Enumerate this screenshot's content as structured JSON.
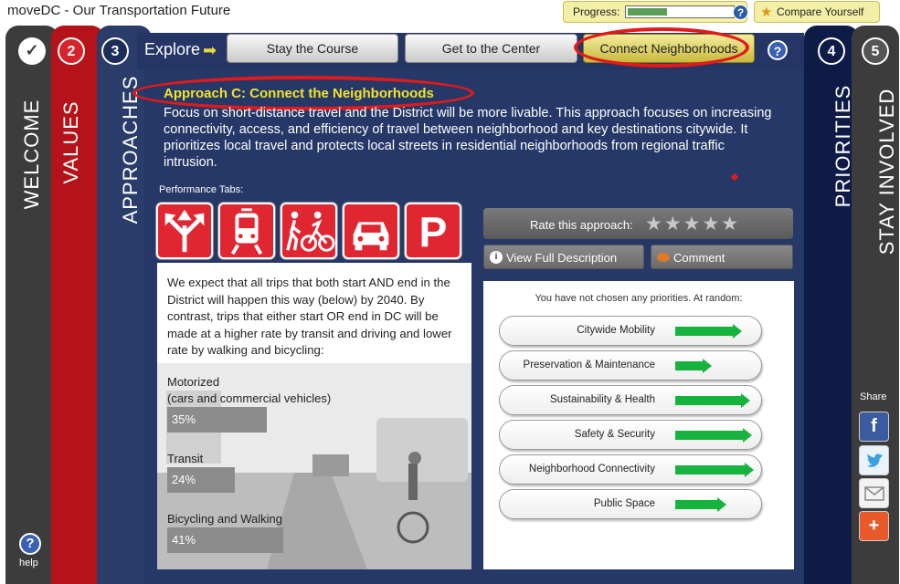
{
  "window": {
    "title": "moveDC - Our Transportation Future"
  },
  "topbar": {
    "progress_label": "Progress:",
    "progress_value": 0.38,
    "progress_help": "?",
    "compare_label": "Compare Yourself"
  },
  "steps": [
    {
      "num": "✓",
      "label": "WELCOME",
      "color": "#3c3c3c"
    },
    {
      "num": "2",
      "label": "VALUES",
      "color": "#b51219"
    },
    {
      "num": "3",
      "label": "APPROACHES",
      "color": "#2a3c6a"
    },
    {
      "num": "4",
      "label": "PRIORITIES",
      "color": "#0f1b47"
    },
    {
      "num": "5",
      "label": "STAY INVOLVED",
      "color": "#3c3c3c"
    }
  ],
  "explore": {
    "label": "Explore",
    "tabs": [
      "Stay the Course",
      "Get to the Center",
      "Connect Neighborhoods"
    ],
    "active_tab": "Connect Neighborhoods",
    "help": "?"
  },
  "approach": {
    "title": "Approach C: Connect the Neighborhoods",
    "description": "Focus on short-distance travel and the District will be more livable. This approach focuses on increasing connectivity, access, and efficiency of travel between neighborhood and key destinations citywide. It prioritizes local travel and protects local streets in residential neighborhoods from regional traffic intrusion."
  },
  "performance": {
    "label": "Performance Tabs:",
    "icons": [
      "roadway-directions-icon",
      "transit-train-icon",
      "walk-bike-icon",
      "car-icon",
      "parking-icon"
    ],
    "intro": "We expect that all trips that both start AND end in the District will happen this way (below) by 2040. By contrast, trips that either start OR end in DC will be made at a higher rate by transit and driving and lower rate by walking and bicycling:",
    "modes": [
      {
        "label": "Motorized\n(cars and commercial vehicles)",
        "value": "35%",
        "share": 35
      },
      {
        "label": "Transit",
        "value": "24%",
        "share": 24
      },
      {
        "label": "Bicycling and Walking",
        "value": "41%",
        "share": 41
      }
    ]
  },
  "rating": {
    "label": "Rate this approach:",
    "stars": "★★★★★"
  },
  "buttons": {
    "view_desc": "View Full Description",
    "comment": "Comment"
  },
  "priorities": {
    "header": "You have not chosen any priorities. At random:",
    "items": [
      {
        "label": "Citywide Mobility",
        "strength": 0.8
      },
      {
        "label": "Preservation & Maintenance",
        "strength": 0.3
      },
      {
        "label": "Sustainability & Health",
        "strength": 0.94
      },
      {
        "label": "Safety & Security",
        "strength": 0.97
      },
      {
        "label": "Neighborhood Connectivity",
        "strength": 1.0
      },
      {
        "label": "Public Space",
        "strength": 0.55
      }
    ]
  },
  "share": {
    "label": "Share"
  },
  "help": {
    "label": "help",
    "icon": "?"
  },
  "colors": {
    "accent_yellow": "#f1e22a",
    "arrow_green": "#17b33f",
    "annotation_red": "#e11a1a"
  }
}
